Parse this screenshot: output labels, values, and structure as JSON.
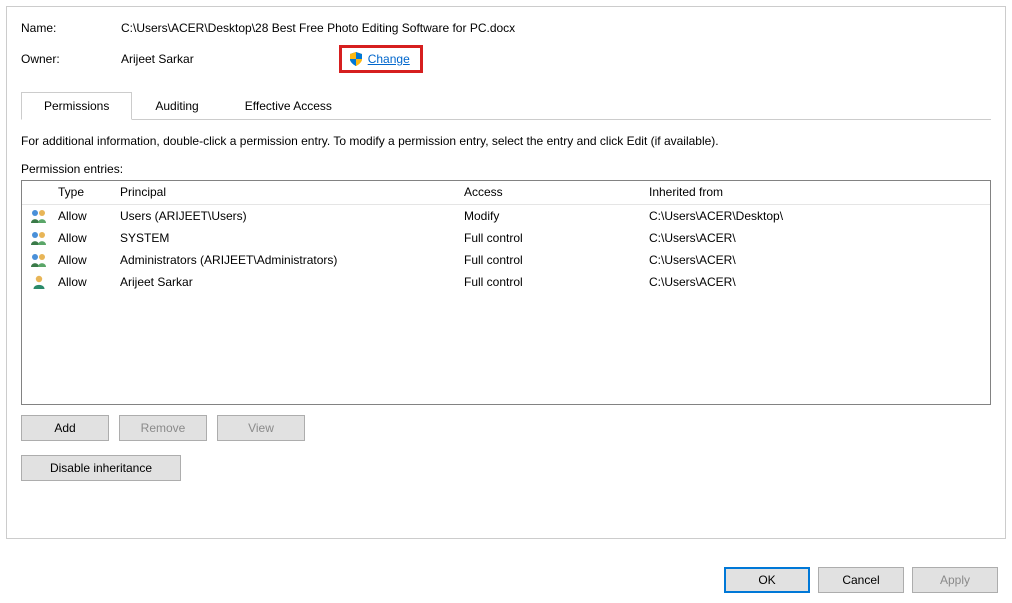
{
  "labels": {
    "name": "Name:",
    "owner": "Owner:"
  },
  "name_value": "C:\\Users\\ACER\\Desktop\\28 Best Free Photo Editing Software for PC.docx",
  "owner_value": "Arijeet Sarkar",
  "change_link": "Change",
  "tabs": {
    "permissions": "Permissions",
    "auditing": "Auditing",
    "effective": "Effective Access"
  },
  "info_text": "For additional information, double-click a permission entry. To modify a permission entry, select the entry and click Edit (if available).",
  "entries_label": "Permission entries:",
  "columns": {
    "type": "Type",
    "principal": "Principal",
    "access": "Access",
    "inherited": "Inherited from"
  },
  "entries": [
    {
      "icon": "group",
      "type": "Allow",
      "principal": "Users (ARIJEET\\Users)",
      "access": "Modify",
      "inherited": "C:\\Users\\ACER\\Desktop\\"
    },
    {
      "icon": "group",
      "type": "Allow",
      "principal": "SYSTEM",
      "access": "Full control",
      "inherited": "C:\\Users\\ACER\\"
    },
    {
      "icon": "group",
      "type": "Allow",
      "principal": "Administrators (ARIJEET\\Administrators)",
      "access": "Full control",
      "inherited": "C:\\Users\\ACER\\"
    },
    {
      "icon": "user",
      "type": "Allow",
      "principal": "Arijeet Sarkar",
      "access": "Full control",
      "inherited": "C:\\Users\\ACER\\"
    }
  ],
  "buttons": {
    "add": "Add",
    "remove": "Remove",
    "view": "View",
    "disable": "Disable inheritance",
    "ok": "OK",
    "cancel": "Cancel",
    "apply": "Apply"
  }
}
